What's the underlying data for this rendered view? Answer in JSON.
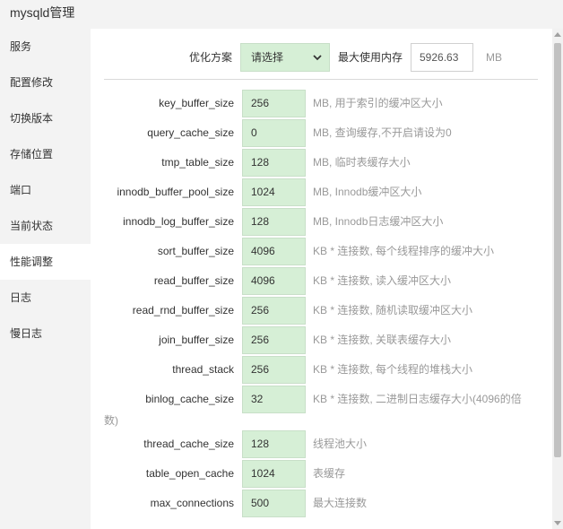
{
  "title": "mysqld管理",
  "sidebar": {
    "items": [
      {
        "label": "服务"
      },
      {
        "label": "配置修改"
      },
      {
        "label": "切换版本"
      },
      {
        "label": "存储位置"
      },
      {
        "label": "端口"
      },
      {
        "label": "当前状态"
      },
      {
        "label": "性能调整",
        "active": true
      },
      {
        "label": "日志"
      },
      {
        "label": "慢日志"
      }
    ]
  },
  "optimize": {
    "label": "优化方案",
    "select_value": "请选择",
    "max_mem_label": "最大使用内存",
    "max_mem_value": "5926.63",
    "max_mem_unit": "MB"
  },
  "params": [
    {
      "name": "key_buffer_size",
      "value": "256",
      "desc": "MB, 用于索引的缓冲区大小"
    },
    {
      "name": "query_cache_size",
      "value": "0",
      "desc": "MB, 查询缓存,不开启请设为0"
    },
    {
      "name": "tmp_table_size",
      "value": "128",
      "desc": "MB, 临时表缓存大小"
    },
    {
      "name": "innodb_buffer_pool_size",
      "value": "1024",
      "desc": "MB, Innodb缓冲区大小"
    },
    {
      "name": "innodb_log_buffer_size",
      "value": "128",
      "desc": "MB, Innodb日志缓冲区大小"
    },
    {
      "name": "sort_buffer_size",
      "value": "4096",
      "desc": "KB * 连接数, 每个线程排序的缓冲大小"
    },
    {
      "name": "read_buffer_size",
      "value": "4096",
      "desc": "KB * 连接数, 读入缓冲区大小"
    },
    {
      "name": "read_rnd_buffer_size",
      "value": "256",
      "desc": "KB * 连接数, 随机读取缓冲区大小"
    },
    {
      "name": "join_buffer_size",
      "value": "256",
      "desc": "KB * 连接数, 关联表缓存大小"
    },
    {
      "name": "thread_stack",
      "value": "256",
      "desc": "KB * 连接数, 每个线程的堆栈大小"
    },
    {
      "name": "binlog_cache_size",
      "value": "32",
      "desc": "KB * 连接数, 二进制日志缓存大小(4096的倍",
      "desc_tail": "数)"
    },
    {
      "name": "thread_cache_size",
      "value": "128",
      "desc": "线程池大小"
    },
    {
      "name": "table_open_cache",
      "value": "1024",
      "desc": "表缓存"
    },
    {
      "name": "max_connections",
      "value": "500",
      "desc": "最大连接数"
    }
  ],
  "colors": {
    "field_bg": "#d6efd6",
    "sidebar_bg": "#f3f3f3",
    "desc_text": "#999999"
  }
}
